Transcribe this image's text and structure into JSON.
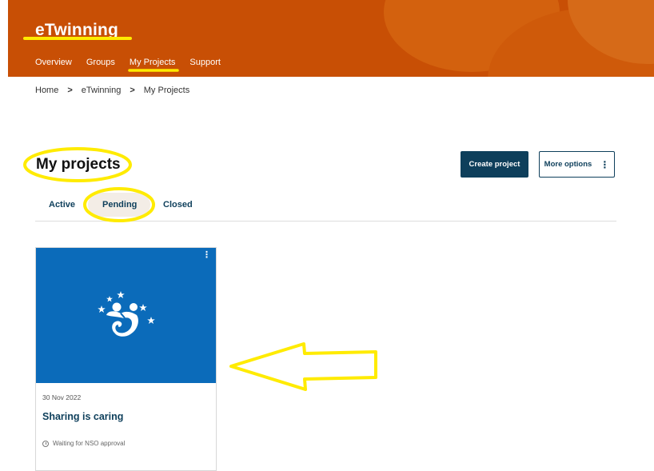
{
  "header": {
    "brand": "eTwinning",
    "nav": [
      "Overview",
      "Groups",
      "My Projects",
      "Support"
    ]
  },
  "breadcrumb": {
    "items": [
      "Home",
      "eTwinning",
      "My Projects"
    ],
    "separator": ">"
  },
  "page": {
    "title": "My projects",
    "create_button": "Create project",
    "more_button": "More options"
  },
  "tabs": [
    "Active",
    "Pending",
    "Closed"
  ],
  "card": {
    "date": "30 Nov 2022",
    "title": "Sharing is caring",
    "status": "Waiting for NSO approval"
  },
  "colors": {
    "header": "#c84f05",
    "primary": "#0e3f5b",
    "card_image": "#0b6bba",
    "annotation": "#ffeb00"
  }
}
